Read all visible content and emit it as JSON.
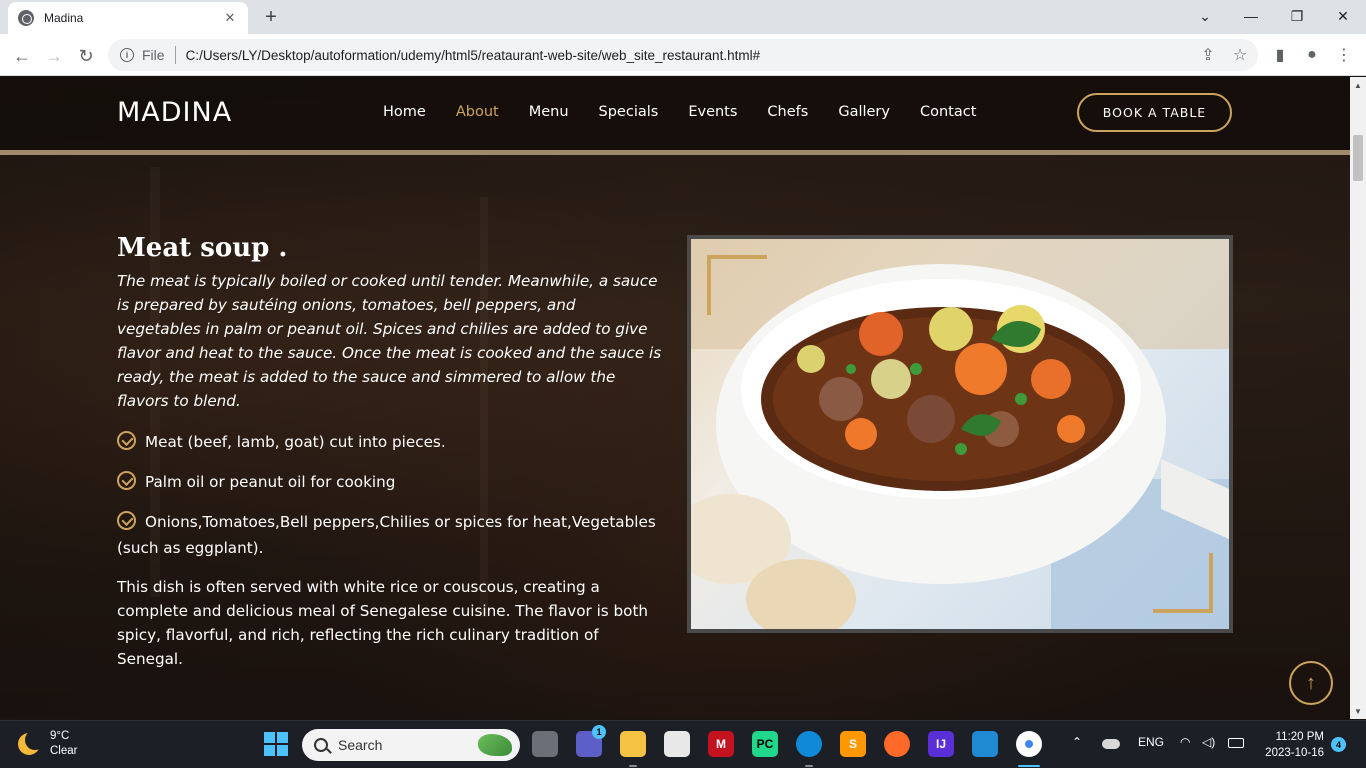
{
  "browser": {
    "tab_title": "Madina",
    "tab_close": "✕",
    "new_tab": "+",
    "scheme_label": "File",
    "url": "C:/Users/LY/Desktop/autoformation/udemy/html5/reataurant-web-site/web_site_restaurant.html#"
  },
  "site": {
    "logo": "MADINA",
    "nav": [
      "Home",
      "About",
      "Menu",
      "Specials",
      "Events",
      "Chefs",
      "Gallery",
      "Contact"
    ],
    "active_nav": "About",
    "book_button": "BOOK A TABLE",
    "accent_color": "#cda45e"
  },
  "dish": {
    "title": "Meat soup .",
    "description": "The meat is typically boiled or cooked until tender. Meanwhile, a sauce is prepared by sautéing onions, tomatoes, bell peppers, and vegetables in palm or peanut oil. Spices and chilies are added to give flavor and heat to the sauce. Once the meat is cooked and the sauce is ready, the meat is added to the sauce and simmered to allow the flavors to blend.",
    "ingredients": [
      "Meat (beef, lamb, goat) cut into pieces.",
      "Palm oil or peanut oil for cooking",
      "Onions,Tomatoes,Bell peppers,Chilies or spices for heat,Vegetables (such as eggplant)."
    ],
    "footer": "This dish is often served with white rice or couscous, creating a complete and delicious meal of Senegalese cuisine. The flavor is both spicy, flavorful, and rich, reflecting the rich culinary tradition of Senegal."
  },
  "taskbar": {
    "weather_temp": "9°C",
    "weather_desc": "Clear",
    "search_placeholder": "Search",
    "teams_badge": "1",
    "language": "ENG",
    "time": "11:20 PM",
    "date": "2023-10-16",
    "notifications": "4"
  }
}
